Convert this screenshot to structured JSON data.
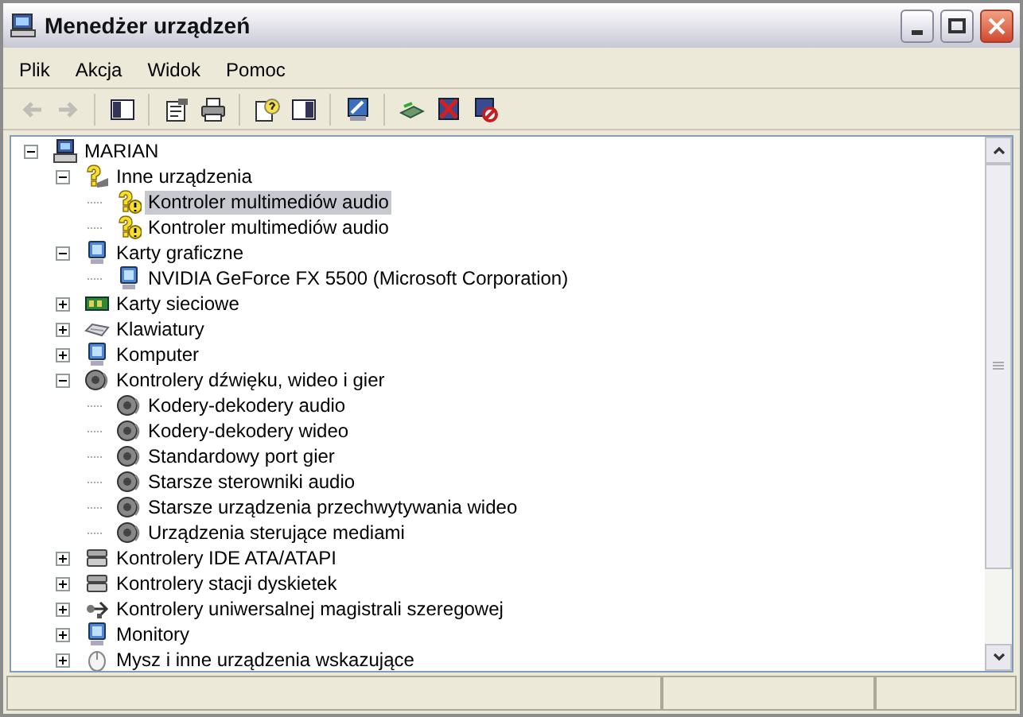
{
  "window": {
    "title": "Menedżer urządzeń"
  },
  "menu": [
    "Plik",
    "Akcja",
    "Widok",
    "Pomoc"
  ],
  "toolbar": [
    [
      {
        "kind": "back",
        "disabled": true
      },
      {
        "kind": "forward",
        "disabled": true
      }
    ],
    [
      {
        "kind": "tree-pane",
        "disabled": false
      }
    ],
    [
      {
        "kind": "properties",
        "disabled": false
      },
      {
        "kind": "print",
        "disabled": false
      }
    ],
    [
      {
        "kind": "help",
        "disabled": false
      },
      {
        "kind": "action-pane",
        "disabled": false
      }
    ],
    [
      {
        "kind": "scan",
        "disabled": false
      }
    ],
    [
      {
        "kind": "update",
        "disabled": false
      },
      {
        "kind": "uninstall",
        "disabled": false
      },
      {
        "kind": "disable",
        "disabled": false
      }
    ]
  ],
  "tree": [
    {
      "label": "MARIAN",
      "kind": "computer",
      "expanded": true,
      "selected": false,
      "children": [
        {
          "label": "Inne urządzenia",
          "kind": "unknown",
          "expanded": true,
          "selected": false,
          "children": [
            {
              "label": "Kontroler multimediów audio",
              "kind": "warning",
              "selected": true
            },
            {
              "label": "Kontroler multimediów audio",
              "kind": "warning",
              "selected": false
            }
          ]
        },
        {
          "label": "Karty graficzne",
          "kind": "display",
          "expanded": true,
          "selected": false,
          "children": [
            {
              "label": "NVIDIA GeForce FX 5500 (Microsoft Corporation)",
              "kind": "display",
              "selected": false
            }
          ]
        },
        {
          "label": "Karty sieciowe",
          "kind": "network",
          "expanded": false,
          "selected": false
        },
        {
          "label": "Klawiatury",
          "kind": "keyboard",
          "expanded": false,
          "selected": false
        },
        {
          "label": "Komputer",
          "kind": "display",
          "expanded": false,
          "selected": false
        },
        {
          "label": "Kontrolery dźwięku, wideo i gier",
          "kind": "sound",
          "expanded": true,
          "selected": false,
          "children": [
            {
              "label": "Kodery-dekodery audio",
              "kind": "sound",
              "selected": false
            },
            {
              "label": "Kodery-dekodery wideo",
              "kind": "sound",
              "selected": false
            },
            {
              "label": "Standardowy port gier",
              "kind": "sound",
              "selected": false
            },
            {
              "label": "Starsze sterowniki audio",
              "kind": "sound",
              "selected": false
            },
            {
              "label": "Starsze urządzenia przechwytywania wideo",
              "kind": "sound",
              "selected": false
            },
            {
              "label": "Urządzenia sterujące mediami",
              "kind": "sound",
              "selected": false
            }
          ]
        },
        {
          "label": "Kontrolery IDE ATA/ATAPI",
          "kind": "drive",
          "expanded": false,
          "selected": false
        },
        {
          "label": "Kontrolery stacji dyskietek",
          "kind": "drive",
          "expanded": false,
          "selected": false
        },
        {
          "label": "Kontrolery uniwersalnej magistrali szeregowej",
          "kind": "usb",
          "expanded": false,
          "selected": false
        },
        {
          "label": "Monitory",
          "kind": "display",
          "expanded": false,
          "selected": false
        },
        {
          "label": "Mysz i inne urządzenia wskazujące",
          "kind": "mouse",
          "expanded": false,
          "selected": false
        }
      ]
    }
  ]
}
